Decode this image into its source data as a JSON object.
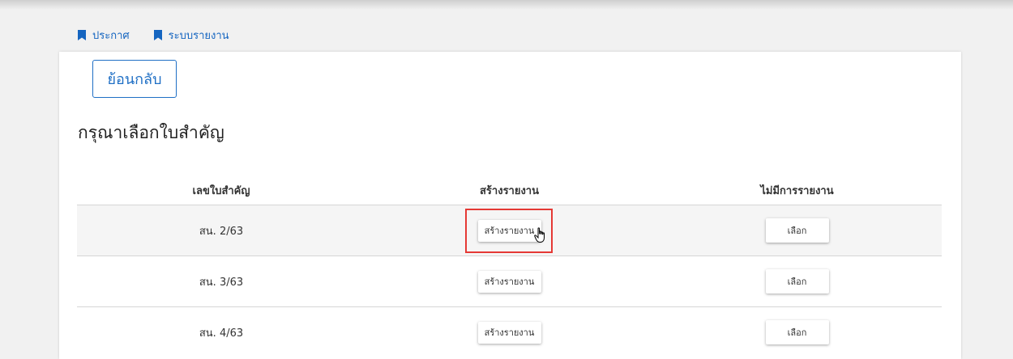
{
  "nav": {
    "items": [
      {
        "label": "ประกาศ",
        "icon": "bookmark-icon"
      },
      {
        "label": "ระบบรายงาน",
        "icon": "bookmark-icon"
      }
    ]
  },
  "back_button_label": "ย้อนกลับ",
  "page_title": "กรุณาเลือกใบสำคัญ",
  "table": {
    "headers": [
      "เลขใบสำคัญ",
      "สร้างรายงาน",
      "ไม่มีการรายงาน"
    ],
    "rows": [
      {
        "number": "สน. 2/63",
        "create_label": "สร้างรายงาน",
        "select_label": "เลือก"
      },
      {
        "number": "สน. 3/63",
        "create_label": "สร้างรายงาน",
        "select_label": "เลือก"
      },
      {
        "number": "สน. 4/63",
        "create_label": "สร้างรายงาน",
        "select_label": "เลือก"
      }
    ]
  },
  "colors": {
    "accent": "#1f6fc5",
    "highlight": "#e53935"
  }
}
